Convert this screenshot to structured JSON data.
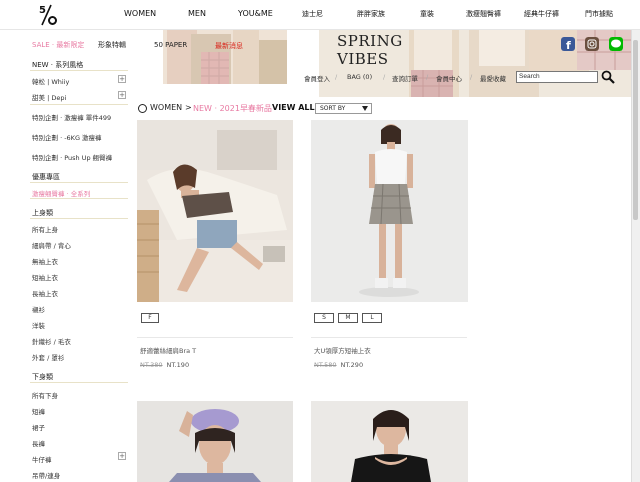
{
  "logo": {
    "text": "5/6"
  },
  "nav": {
    "items": [
      "WOMEN",
      "MEN",
      "YOU&ME",
      "迪士尼",
      "胖胖家族",
      "童裝",
      "激瘦翹臀褲",
      "經典牛仔褲",
      "門市據點"
    ]
  },
  "banner": {
    "sale_label": "SALE · 最新限定",
    "image_label": "形象特輯",
    "paper_label": "50 PAPER",
    "newest_label": "最新消息",
    "spring": "SPRING",
    "vibes": "VIBES"
  },
  "account": {
    "login": "會員登入",
    "bag": "BAG (0)",
    "orders": "查詢訂單",
    "member": "會員中心",
    "favorites": "最愛收藏",
    "search_placeholder": "Search"
  },
  "sidebar": {
    "new_heading": "NEW · 系列風格",
    "series": [
      "韓松 | Whiiy",
      "甜美 | Depi"
    ],
    "specials": [
      "特別企劃 · 激瘦褲 單件499",
      "特別企劃 · -6KG 激瘦褲",
      "特別企劃 · Push Up 翹臀褲"
    ],
    "promo_heading": "優惠專區",
    "promo_item": "激瘦翹臀褲 · 全系列",
    "tops_heading": "上身類",
    "tops": [
      "所有上身",
      "細肩帶 / 背心",
      "無袖上衣",
      "短袖上衣",
      "長袖上衣",
      "襯衫",
      "洋裝",
      "針織衫 / 毛衣",
      "外套 / 罩衫"
    ],
    "bottoms_heading": "下身類",
    "bottoms": [
      "所有下身",
      "短褲",
      "裙子",
      "長褲",
      "牛仔褲",
      "吊帶/連身"
    ]
  },
  "breadcrumb": {
    "women": "WOMEN",
    "sep": ">",
    "new_label": "NEW · 2021早春新品",
    "view_all": "VIEW ALL",
    "sort_label": "SORT BY"
  },
  "products": [
    {
      "sizes": [
        "F"
      ],
      "name": "舒適蕾絲細肩Bra T",
      "old_price": "NT.380",
      "new_price": "NT.190"
    },
    {
      "sizes": [
        "S",
        "M",
        "L"
      ],
      "name": "大U領厚方短袖上衣",
      "old_price": "NT.580",
      "new_price": "NT.290"
    }
  ],
  "colors": {
    "accent_pink": "#e87aa2",
    "red": "#d9251b"
  },
  "icons": {
    "search": "magnifier-icon",
    "facebook": "facebook-icon",
    "instagram": "instagram-icon",
    "line": "line-icon"
  }
}
